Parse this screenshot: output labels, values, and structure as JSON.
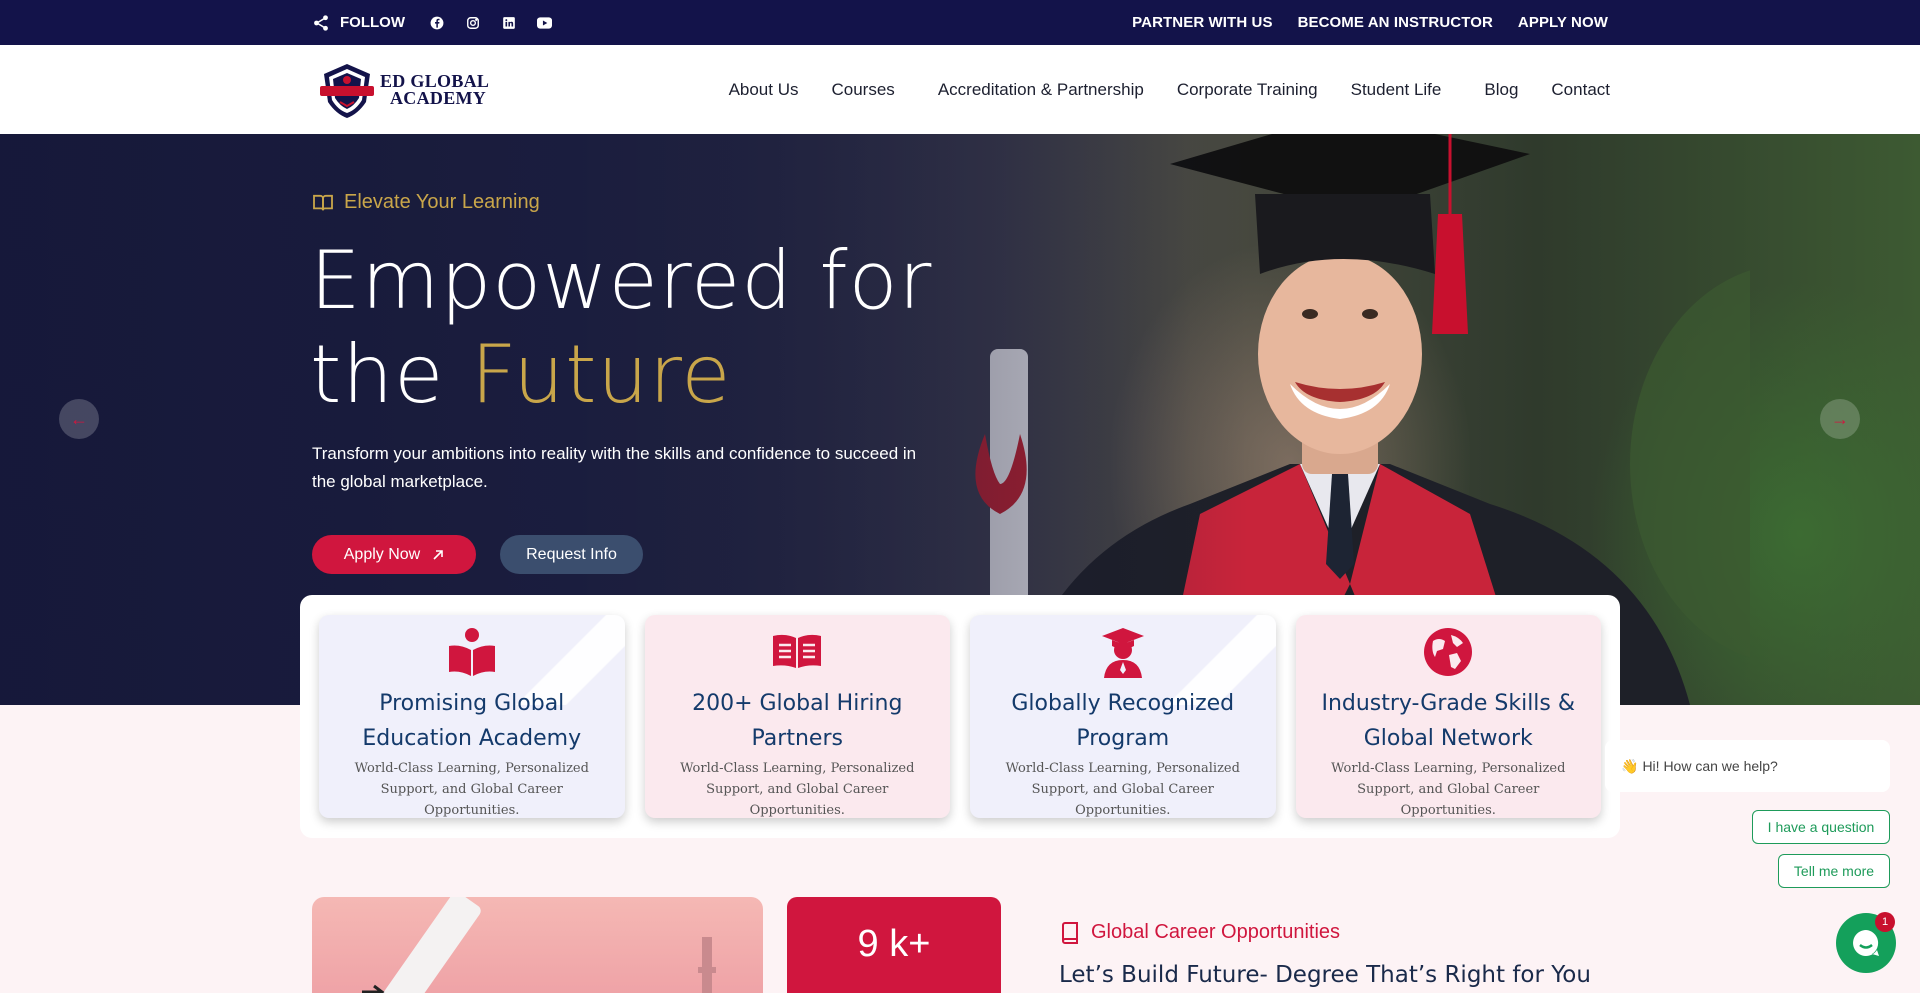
{
  "topbar": {
    "follow_label": "FOLLOW",
    "social_icons": [
      "facebook-icon",
      "instagram-icon",
      "linkedin-icon",
      "youtube-icon"
    ],
    "links": [
      "PARTNER WITH US",
      "BECOME AN INSTRUCTOR",
      "APPLY NOW"
    ]
  },
  "header": {
    "logo_line1": "ED GLOBAL",
    "logo_line2": "ACADEMY",
    "nav": {
      "about": "About Us",
      "courses": "Courses",
      "accreditation": "Accreditation & Partnership",
      "corporate": "Corporate Training",
      "student_life": "Student Life",
      "blog": "Blog",
      "contact": "Contact"
    },
    "caret_glyph": ""
  },
  "hero": {
    "eyebrow": "Elevate Your Learning",
    "headline_line1": "Empowered for",
    "headline_line2_a": "the ",
    "headline_line2_b": "Future",
    "text": "Transform your ambitions into reality with the skills and confidence to succeed in the global marketplace.",
    "apply_label": "Apply Now",
    "info_label": "Request Info"
  },
  "features": [
    {
      "title": "Promising Global Education Academy",
      "text": "World-Class Learning, Personalized Support, and Global Career Opportunities."
    },
    {
      "title": "200+ Global Hiring Partners",
      "text": "World-Class Learning, Personalized Support, and Global Career Opportunities."
    },
    {
      "title": "Globally Recognized Program",
      "text": "World-Class Learning, Personalized Support, and Global Career Opportunities."
    },
    {
      "title": "Industry-Grade Skills & Global Network",
      "text": "World-Class Learning, Personalized Support, and Global Career Opportunities."
    }
  ],
  "bottom": {
    "stat": "9 k+",
    "eyebrow": "Global Career Opportunities",
    "heading": "Let’s Build Future- Degree That’s Right for You"
  },
  "chat": {
    "greeting": "Hi! How can we help?",
    "option1": "I have a question",
    "option2": "Tell me more",
    "badge": "1"
  },
  "colors": {
    "navy": "#13134a",
    "accent_red": "#d0163e",
    "gold": "#c9a64a",
    "chat_green": "#14a05b"
  }
}
